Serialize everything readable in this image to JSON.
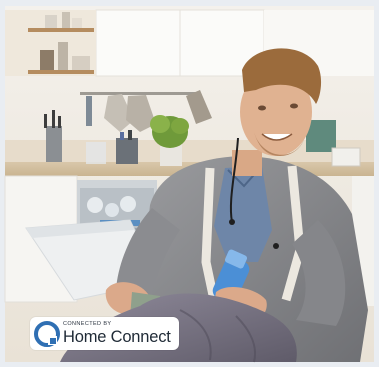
{
  "image": {
    "alt_subject": "kitchen-scene-man-unloading-dishwasher",
    "badge": {
      "connected_by": "CONNECTED BY",
      "brand": "Home Connect",
      "icon": "home-connect-logo-icon",
      "accent_color": "#2f6fb3"
    }
  }
}
